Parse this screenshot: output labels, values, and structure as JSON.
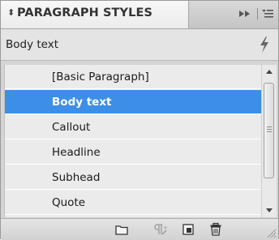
{
  "panel": {
    "tab_arrows": "⬍",
    "title": "PARAGRAPH STYLES",
    "icons": {
      "collapse": "double-chevron-right-icon",
      "menu": "panel-menu-icon"
    }
  },
  "current_style": {
    "label": "Body text",
    "icon": "lightning-icon"
  },
  "styles": [
    {
      "label": "[Basic Paragraph]",
      "selected": false
    },
    {
      "label": "Body text",
      "selected": true
    },
    {
      "label": "Callout",
      "selected": false
    },
    {
      "label": "Headline",
      "selected": false
    },
    {
      "label": "Subhead",
      "selected": false
    },
    {
      "label": "Quote",
      "selected": false
    }
  ],
  "scrollbar": {
    "position": 0.1
  },
  "footer_icons": [
    "new-group-folder-icon",
    "clear-overrides-icon",
    "new-style-icon",
    "trash-icon"
  ],
  "colors": {
    "selection": "#3d8ee7",
    "list_background": "#ebebeb",
    "panel_background": "#d4d4d4"
  }
}
